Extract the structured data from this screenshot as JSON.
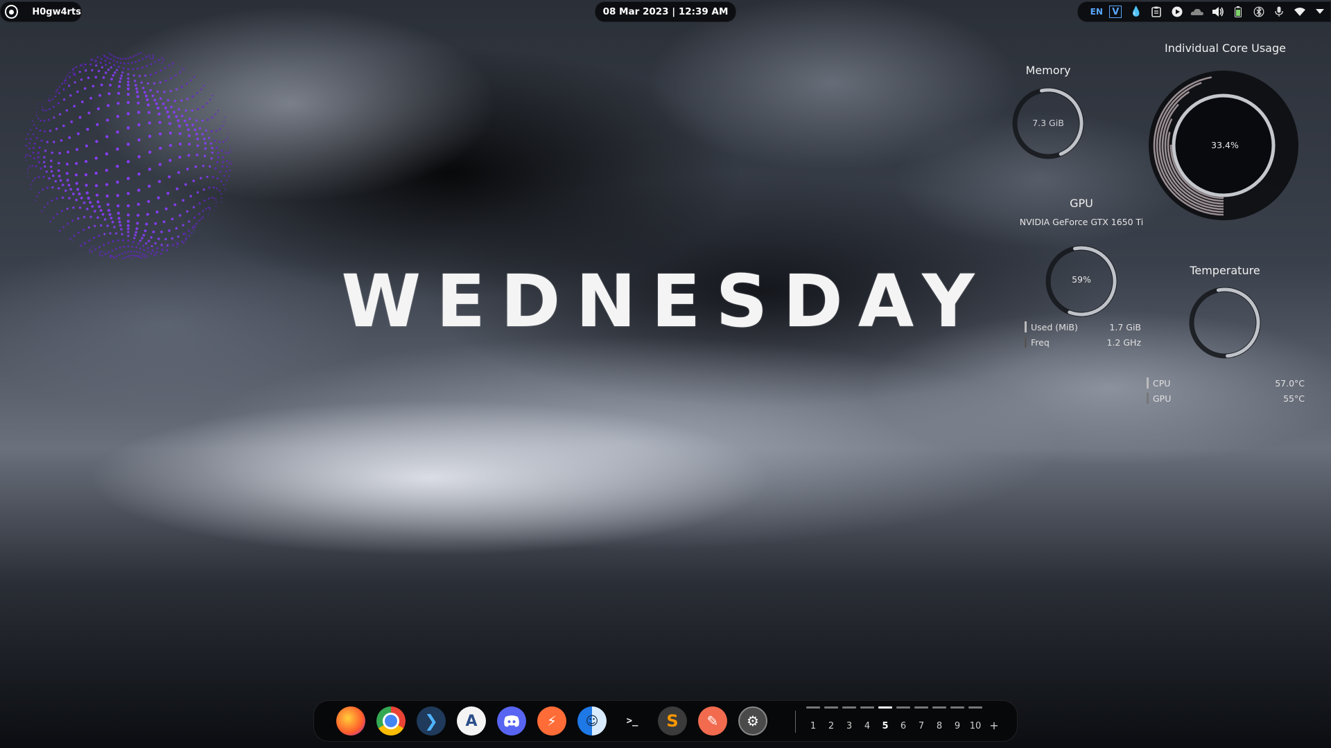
{
  "topbar": {
    "username": "H0gw4rts",
    "clock": "08 Mar 2023 | 12:39 AM",
    "tray": {
      "language": "EN",
      "icons": [
        "vector-app-icon",
        "color-picker-icon",
        "clipboard-icon",
        "media-play-icon",
        "cloud-icon",
        "volume-icon",
        "battery-icon",
        "bluetooth-icon",
        "microphone-icon",
        "wifi-icon",
        "chevron-down-icon"
      ]
    }
  },
  "desktop": {
    "title": "WEDNESDAY"
  },
  "widgets": {
    "memory": {
      "label": "Memory",
      "value": "7.3 GiB",
      "fraction": 0.47
    },
    "gpu": {
      "label": "GPU",
      "model": "NVIDIA GeForce GTX 1650 Ti",
      "usage": "59%",
      "fraction": 0.59,
      "stats": [
        {
          "name": "Used (MiB)",
          "value": "1.7 GiB"
        },
        {
          "name": "Freq",
          "value": "1.2 GHz"
        }
      ]
    },
    "core_usage": {
      "label": "Individual Core Usage",
      "value": "33.4%",
      "fraction": 0.334,
      "cores": [
        0.9,
        0.85,
        0.78,
        0.7,
        0.62,
        0.55,
        0.48,
        0.42
      ]
    },
    "temperature": {
      "label": "Temperature",
      "fraction": 0.52,
      "stats": [
        {
          "name": "CPU",
          "value": "57.0°C"
        },
        {
          "name": "GPU",
          "value": "55°C"
        }
      ]
    }
  },
  "dock": {
    "apps": [
      {
        "name": "Firefox",
        "icon": "firefox-icon",
        "color": "#ff7139"
      },
      {
        "name": "Chrome",
        "icon": "chrome-icon",
        "color": "#4285f4"
      },
      {
        "name": "VS Code",
        "icon": "vscode-icon",
        "color": "#1e6fb3"
      },
      {
        "name": "Android Studio",
        "icon": "android-studio-icon",
        "color": "#f2f2f2"
      },
      {
        "name": "Discord",
        "icon": "discord-icon",
        "color": "#5865f2"
      },
      {
        "name": "Postman",
        "icon": "postman-icon",
        "color": "#ff6c37"
      },
      {
        "name": "Finder",
        "icon": "finder-icon",
        "color": "#3d8ef0"
      },
      {
        "name": "Terminal",
        "icon": "terminal-icon",
        "color": "#3a2a22"
      },
      {
        "name": "Sublime Text",
        "icon": "sublime-icon",
        "color": "#4a4a4a"
      },
      {
        "name": "Text Editor",
        "icon": "pencil-icon",
        "color": "#f26b4f"
      },
      {
        "name": "Settings",
        "icon": "settings-icon",
        "color": "#5a5a5a"
      }
    ],
    "workspaces": [
      "1",
      "2",
      "3",
      "4",
      "5",
      "6",
      "7",
      "8",
      "9",
      "10"
    ],
    "active_workspace": "5",
    "add_label": "+"
  }
}
